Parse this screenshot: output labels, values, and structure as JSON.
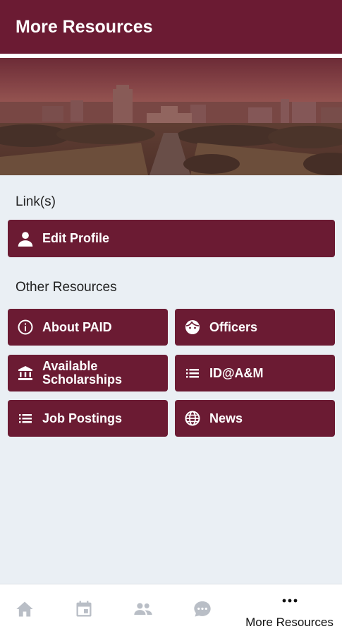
{
  "header": {
    "title": "More Resources"
  },
  "sections": {
    "links_label": "Link(s)",
    "other_label": "Other Resources"
  },
  "links": [
    {
      "label": "Edit Profile",
      "icon": "person-icon"
    }
  ],
  "resources": [
    {
      "label": "About PAID",
      "icon": "info-icon"
    },
    {
      "label": "Officers",
      "icon": "face-icon"
    },
    {
      "label": "Available Scholarships",
      "line1": "Available",
      "line2": "Scholarships",
      "icon": "bank-icon"
    },
    {
      "label": "ID@A&M",
      "icon": "list-icon"
    },
    {
      "label": "Job Postings",
      "icon": "list-icon"
    },
    {
      "label": "News",
      "icon": "globe-icon"
    }
  ],
  "bottom_nav": {
    "items": [
      {
        "name": "home",
        "icon": "home-icon"
      },
      {
        "name": "calendar",
        "icon": "calendar-icon"
      },
      {
        "name": "people",
        "icon": "people-icon"
      },
      {
        "name": "chat",
        "icon": "chat-icon"
      },
      {
        "name": "more",
        "icon": "more-dots-icon",
        "label": "More Resources",
        "active": true
      }
    ]
  },
  "colors": {
    "primary": "#6b1b33",
    "background": "#eaeff4",
    "nav_inactive": "#b9bec6"
  }
}
